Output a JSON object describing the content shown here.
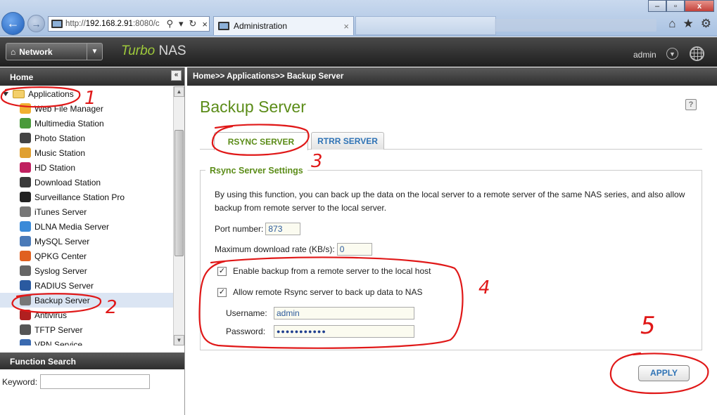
{
  "browser": {
    "url_prefix": "http://",
    "url_host": "192.168.2.91",
    "url_rest": ":8080/c",
    "tab_title": "Administration",
    "tab_close": "×",
    "window_buttons": [
      "–",
      "▫",
      "x"
    ],
    "toolbar_icons": [
      "⌂",
      "★",
      "⚙"
    ],
    "address_tools": [
      "⚲",
      "▾",
      "↻",
      "×"
    ]
  },
  "header": {
    "menu_label": "Network",
    "product_accent": "Turbo",
    "product_name": "NAS",
    "user": "admin",
    "accent_color": "#9ec93b"
  },
  "sidebar": {
    "title": "Home",
    "collapse": "«",
    "root": "Applications",
    "items": [
      {
        "label": "Web File Manager",
        "icon": "folder-icon",
        "color": "#f0b030"
      },
      {
        "label": "Multimedia Station",
        "icon": "multimedia-icon",
        "color": "#4a9a3a"
      },
      {
        "label": "Photo Station",
        "icon": "photo-icon",
        "color": "#444"
      },
      {
        "label": "Music Station",
        "icon": "music-icon",
        "color": "#e0a030"
      },
      {
        "label": "HD Station",
        "icon": "hd-icon",
        "color": "#c02060"
      },
      {
        "label": "Download Station",
        "icon": "download-icon",
        "color": "#3a3a3a"
      },
      {
        "label": "Surveillance Station Pro",
        "icon": "camera-icon",
        "color": "#222"
      },
      {
        "label": "iTunes Server",
        "icon": "apple-icon",
        "color": "#777"
      },
      {
        "label": "DLNA Media Server",
        "icon": "dlna-icon",
        "color": "#3a8ad8"
      },
      {
        "label": "MySQL Server",
        "icon": "database-icon",
        "color": "#4a7ab8"
      },
      {
        "label": "QPKG Center",
        "icon": "qpkg-icon",
        "color": "#e06020"
      },
      {
        "label": "Syslog Server",
        "icon": "syslog-icon",
        "color": "#666"
      },
      {
        "label": "RADIUS Server",
        "icon": "radius-icon",
        "color": "#2a5aa0"
      },
      {
        "label": "Backup Server",
        "icon": "backup-icon",
        "color": "#777",
        "selected": true
      },
      {
        "label": "Antivirus",
        "icon": "antivirus-icon",
        "color": "#b02020"
      },
      {
        "label": "TFTP Server",
        "icon": "tftp-icon",
        "color": "#555"
      },
      {
        "label": "VPN Service",
        "icon": "vpn-icon",
        "color": "#3a6ab0"
      }
    ],
    "function_search_title": "Function Search",
    "keyword_label": "Keyword:",
    "keyword_value": ""
  },
  "main": {
    "breadcrumb": "Home>> Applications>> Backup Server",
    "title": "Backup Server",
    "help": "?",
    "tabs": [
      {
        "label": "RSYNC SERVER",
        "active": true
      },
      {
        "label": "RTRR SERVER",
        "active": false
      }
    ],
    "settings_title": "Rsync Server Settings",
    "description": "By using this function, you can back up the data on the local server to a remote server of the same NAS series, and also allow backup from remote server to the local server.",
    "port_label": "Port number:",
    "port_value": "873",
    "rate_label": "Maximum download rate (KB/s):",
    "rate_value": "0",
    "check1_label": "Enable backup from a remote server to the local host",
    "check1_mark": "✓",
    "check2_label": "Allow remote Rsync server to back up data to NAS",
    "check2_mark": "✓",
    "username_label": "Username:",
    "username_value": "admin",
    "password_label": "Password:",
    "password_value": "●●●●●●●●●●●",
    "apply_label": "APPLY"
  },
  "annotations": [
    "1",
    "2",
    "3",
    "4",
    "5"
  ]
}
